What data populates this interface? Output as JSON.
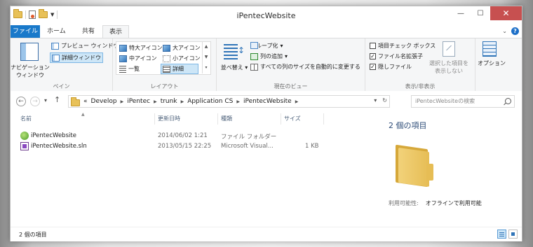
{
  "window": {
    "title": "iPentecWebsite"
  },
  "window_controls": {
    "minimize": "—",
    "maximize": "☐",
    "close": "✕"
  },
  "tabs": [
    {
      "label": "ファイル"
    },
    {
      "label": "ホーム"
    },
    {
      "label": "共有"
    },
    {
      "label": "表示"
    }
  ],
  "help": "?",
  "ribbon": {
    "pane": {
      "label": "ペイン",
      "nav_pane": "ナビゲーション\nウィンドウ",
      "preview": "プレビュー ウィンドウ",
      "details": "詳細ウィンドウ"
    },
    "layout": {
      "label": "レイアウト",
      "items": [
        "特大アイコン",
        "大アイコン",
        "中アイコン",
        "小アイコン",
        "一覧",
        "詳細"
      ],
      "selected": "詳細"
    },
    "current_view": {
      "label": "現在のビュー",
      "sort": "並べ替え",
      "group_by": "グループ化",
      "add_columns": "列の追加",
      "fit_columns": "すべての列のサイズを自動的に変更する"
    },
    "show_hide": {
      "label": "表示/非表示",
      "item_checkboxes": {
        "label": "項目チェック ボックス",
        "checked": false
      },
      "file_extensions": {
        "label": "ファイル名拡張子",
        "checked": true
      },
      "hidden_items": {
        "label": "隠しファイル",
        "checked": true
      },
      "hide_selected": "選択した項目を\n表示しない"
    },
    "options": {
      "label": "オプション"
    }
  },
  "navigation": {
    "back": "←",
    "forward": "→",
    "up": "↑",
    "overflow": "«",
    "breadcrumb": [
      "Develop",
      "iPentec",
      "trunk",
      "Application CS",
      "iPentecWebsite"
    ],
    "search_placeholder": "iPentecWebsiteの検索"
  },
  "columns": [
    "名前",
    "更新日時",
    "種類",
    "サイズ"
  ],
  "files": [
    {
      "name": "iPentecWebsite",
      "modified": "2014/06/02 1:21",
      "type": "ファイル フォルダー",
      "size": "",
      "icon": "web-project-folder-icon"
    },
    {
      "name": "iPentecWebsite.sln",
      "modified": "2013/05/15 22:25",
      "type": "Microsoft Visual...",
      "size": "1 KB",
      "icon": "visual-studio-solution-icon"
    }
  ],
  "details_pane": {
    "title": "2 個の項目",
    "availability_label": "利用可能性:",
    "availability_value": "オフラインで利用可能"
  },
  "status": {
    "item_count": "2 個の項目"
  },
  "colors": {
    "file_tab": "#1979ca",
    "accent": "#2f74b8",
    "close_button": "#c75050",
    "folder": "#e6bd55"
  }
}
